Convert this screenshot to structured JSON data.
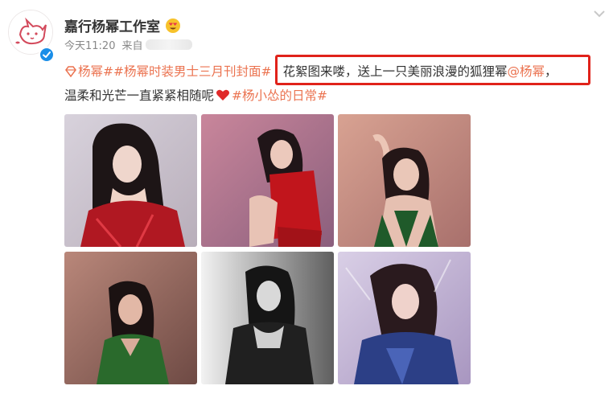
{
  "post": {
    "author_name": "嘉行杨幂工作室",
    "time": "今天11:20",
    "source_prefix": "来自",
    "line1": {
      "tag1": "杨幂#",
      "tag2": "#杨幂时装男士三月刊封面#",
      "text": "花絮图来喽，送上一只美丽浪漫的狐狸幂",
      "mention": "@杨幂",
      "end": "，"
    },
    "line2": {
      "text": "温柔和光芒一直紧紧相随呢",
      "tag": "#杨小怂的日常#"
    }
  },
  "photos": [
    {
      "label": "photo-1",
      "bg": "#cfc5cf",
      "accent": "#b01822"
    },
    {
      "label": "photo-2",
      "bg": "#b77a93",
      "accent": "#c1151c"
    },
    {
      "label": "photo-3",
      "bg": "#c98a82",
      "accent": "#1f5a2a"
    },
    {
      "label": "photo-4",
      "bg": "#9a6c62",
      "accent": "#2a6a2c"
    },
    {
      "label": "photo-5",
      "bg": "#9a9a9a",
      "accent": "#202020"
    },
    {
      "label": "photo-6",
      "bg": "#c6b7d6",
      "accent": "#2c3f86"
    }
  ],
  "colors": {
    "link": "#eb7350",
    "highlight_border": "#e0221a",
    "verified": "#1a8ee8"
  },
  "icons": {
    "verified": "verified-badge-icon",
    "emoji": "heart-eyes-emoji-icon",
    "chevron": "chevron-down-icon",
    "topic": "topic-diamond-icon",
    "heart": "heart-icon"
  }
}
